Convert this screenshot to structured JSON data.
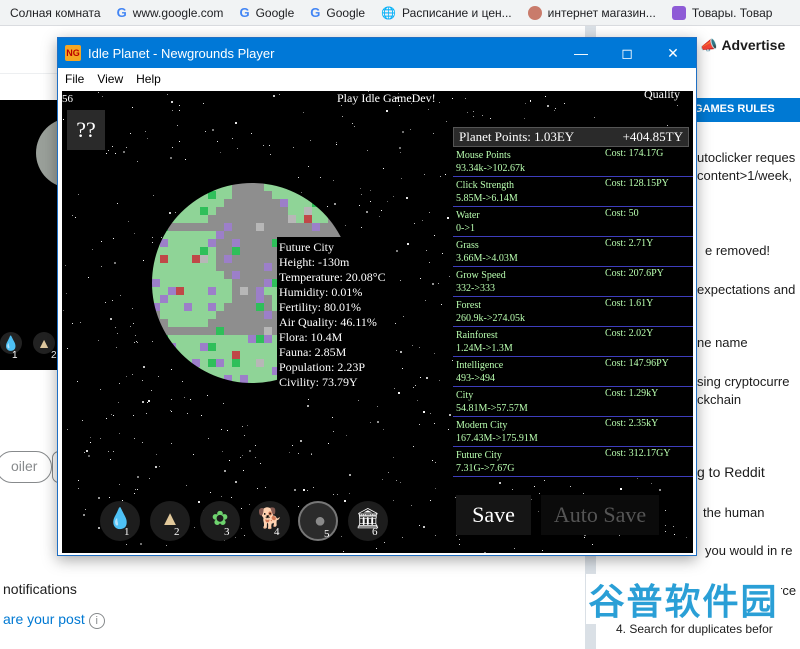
{
  "bookmarks": [
    {
      "label": "Солная комната",
      "icon": "none"
    },
    {
      "label": "www.google.com",
      "icon": "google"
    },
    {
      "label": "Google",
      "icon": "google"
    },
    {
      "label": "Google",
      "icon": "google"
    },
    {
      "label": "Расписание и цен...",
      "icon": "globe"
    },
    {
      "label": "интернет магазин...",
      "icon": "avatar"
    },
    {
      "label": "Товары. Товар",
      "icon": "box"
    }
  ],
  "reddit": {
    "advertise": "Advertise",
    "rules_title": "GAMES RULES",
    "rules": [
      "utoclicker reques",
      "content>1/week,",
      "e removed!",
      "expectations and",
      "ne name",
      "sing cryptocurre",
      "ckchain",
      "g to Reddit",
      "the human",
      "you would in re",
      "rce"
    ],
    "pill_spoiler": "oiler",
    "notifications": "notifications",
    "share": "are your post",
    "search_duplicates": "4. Search for duplicates befor",
    "watermark": "谷普软件园"
  },
  "window": {
    "title": "Idle Planet - Newgrounds Player",
    "logo": "NG",
    "menu": [
      "File",
      "View",
      "Help"
    ]
  },
  "game": {
    "fps": "56",
    "play_link": "Play Idle GameDev!",
    "quality": "Quality",
    "help": "??",
    "planet_points_label": "Planet Points: 1.03EY",
    "planet_points_rate": "+404.85TY",
    "tooltip": [
      "Future City",
      "Height: -130m",
      "Temperature: 20.08°C",
      "Humidity: 0.01%",
      "Fertility: 80.01%",
      "Air Quality: 46.11%",
      "Flora: 10.4M",
      "Fauna: 2.85M",
      "Population: 2.23P",
      "Civility: 73.79Y"
    ],
    "upgrades": [
      {
        "name": "Mouse Points",
        "rate": "93.34k->102.67k",
        "cost": "Cost: 174.17G"
      },
      {
        "name": "Click Strength",
        "rate": "5.85M->6.14M",
        "cost": "Cost: 128.15PY"
      },
      {
        "name": "Water",
        "rate": "0->1",
        "cost": "Cost: 50"
      },
      {
        "name": "Grass",
        "rate": "3.66M->4.03M",
        "cost": "Cost: 2.71Y"
      },
      {
        "name": "Grow Speed",
        "rate": "332->333",
        "cost": "Cost: 207.6PY"
      },
      {
        "name": "Forest",
        "rate": "260.9k->274.05k",
        "cost": "Cost: 1.61Y"
      },
      {
        "name": "Rainforest",
        "rate": "1.24M->1.3M",
        "cost": "Cost: 2.02Y"
      },
      {
        "name": "Intelligence",
        "rate": "493->494",
        "cost": "Cost: 147.96PY"
      },
      {
        "name": "City",
        "rate": "54.81M->57.57M",
        "cost": "Cost: 1.29kY"
      },
      {
        "name": "Modern City",
        "rate": "167.43M->175.91M",
        "cost": "Cost: 2.35kY"
      },
      {
        "name": "Future City",
        "rate": "7.31G->7.67G",
        "cost": "Cost: 312.17GY"
      }
    ],
    "save": "Save",
    "auto_save": "Auto Save",
    "tools": [
      {
        "icon": "water-drop-icon",
        "num": "1"
      },
      {
        "icon": "sand-icon",
        "num": "2"
      },
      {
        "icon": "plant-icon",
        "num": "3"
      },
      {
        "icon": "animal-icon",
        "num": "4"
      },
      {
        "icon": "people-icon",
        "num": "5"
      },
      {
        "icon": "building-icon",
        "num": "6"
      }
    ],
    "side_tools": [
      {
        "icon": "water-drop-icon",
        "num": "1"
      },
      {
        "icon": "sand-icon",
        "num": "2"
      }
    ]
  }
}
